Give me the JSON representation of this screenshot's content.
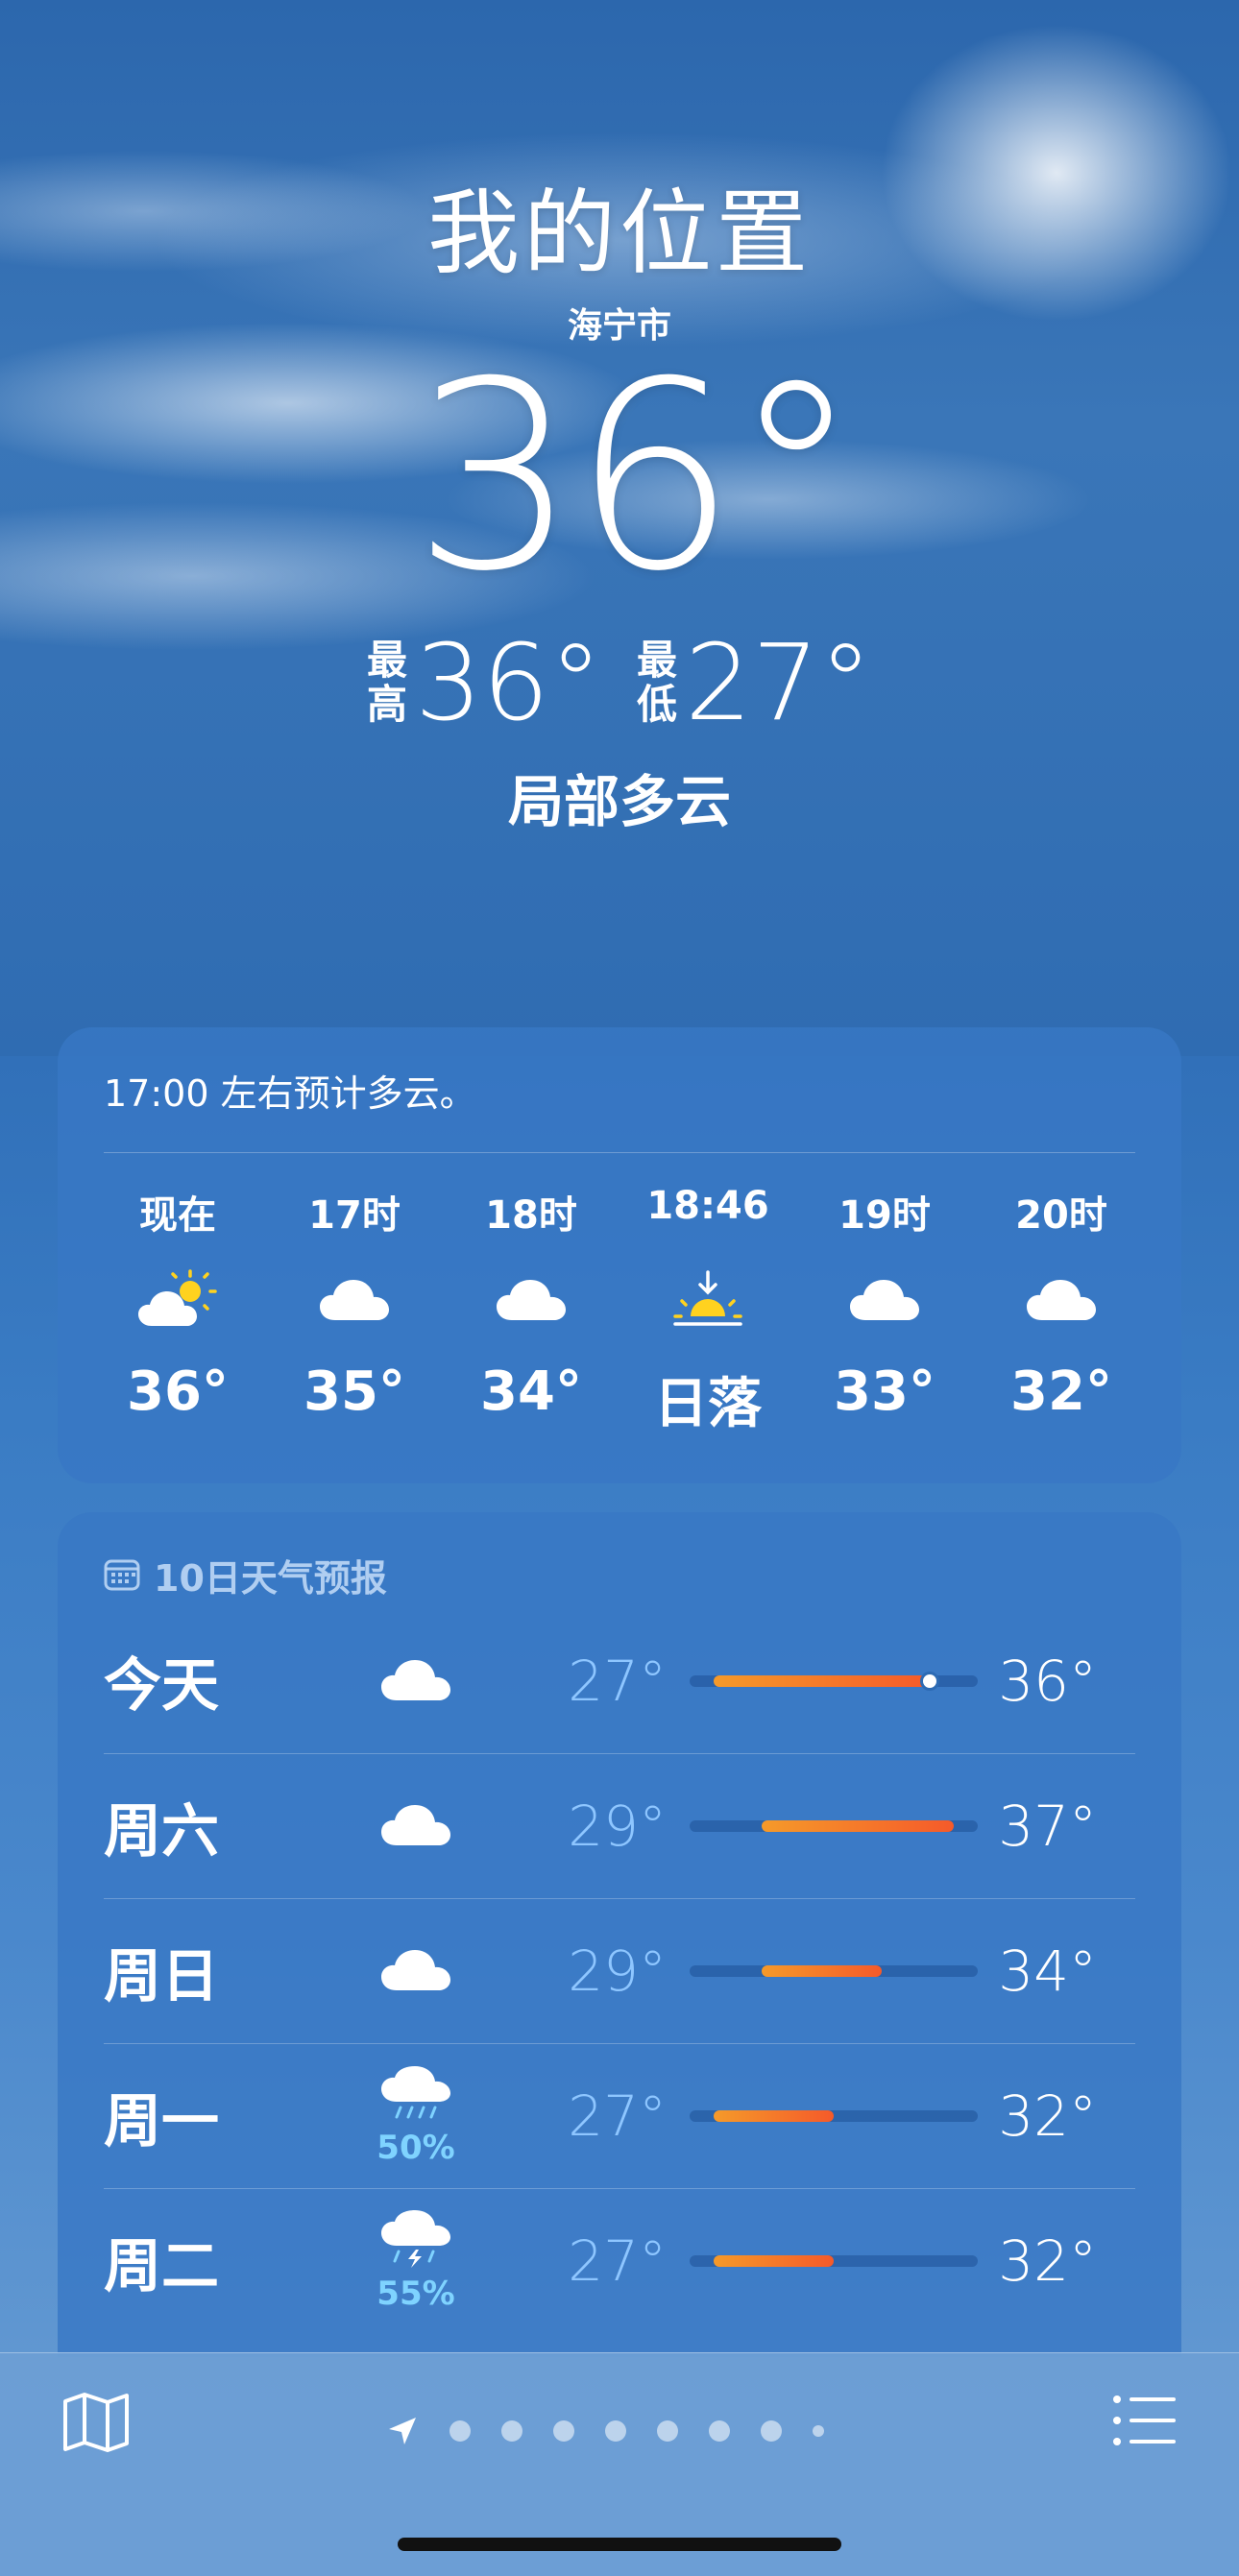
{
  "location": {
    "title": "我的位置",
    "city": "海宁市"
  },
  "current": {
    "temp": "36°",
    "high_label": "最高",
    "high_label_top": "最",
    "high_label_bottom": "高",
    "high": "36°",
    "low_label_top": "最",
    "low_label_bottom": "低",
    "low": "27°",
    "condition": "局部多云"
  },
  "hourly": {
    "summary": "17:00 左右预计多云。",
    "items": [
      {
        "label": "现在",
        "icon": "partly-sunny-icon",
        "temp": "36°"
      },
      {
        "label": "17时",
        "icon": "cloud-icon",
        "temp": "35°"
      },
      {
        "label": "18时",
        "icon": "cloud-icon",
        "temp": "34°"
      },
      {
        "label": "18:46",
        "icon": "sunset-icon",
        "temp": "日落"
      },
      {
        "label": "19时",
        "icon": "cloud-icon",
        "temp": "33°"
      },
      {
        "label": "20时",
        "icon": "cloud-icon",
        "temp": "32°"
      }
    ]
  },
  "daily": {
    "header": "10日天气预报",
    "range": [
      26,
      38
    ],
    "items": [
      {
        "day": "今天",
        "icon": "cloud-icon",
        "precip": "",
        "low": "27°",
        "high": "36°",
        "low_val": 27,
        "high_val": 36,
        "current_val": 36
      },
      {
        "day": "周六",
        "icon": "cloud-icon",
        "precip": "",
        "low": "29°",
        "high": "37°",
        "low_val": 29,
        "high_val": 37
      },
      {
        "day": "周日",
        "icon": "cloud-icon",
        "precip": "",
        "low": "29°",
        "high": "34°",
        "low_val": 29,
        "high_val": 34
      },
      {
        "day": "周一",
        "icon": "rain-cloud-icon",
        "precip": "50%",
        "low": "27°",
        "high": "32°",
        "low_val": 27,
        "high_val": 32
      },
      {
        "day": "周二",
        "icon": "thunderstorm-icon",
        "precip": "55%",
        "low": "27°",
        "high": "32°",
        "low_val": 27,
        "high_val": 32
      }
    ]
  },
  "colors": {
    "accent_precip": "#7fd3ff",
    "bar_warm": "#f55a2a",
    "bar_mild": "#f59a2a"
  },
  "page_indicator": {
    "count": 9,
    "active": 0
  }
}
